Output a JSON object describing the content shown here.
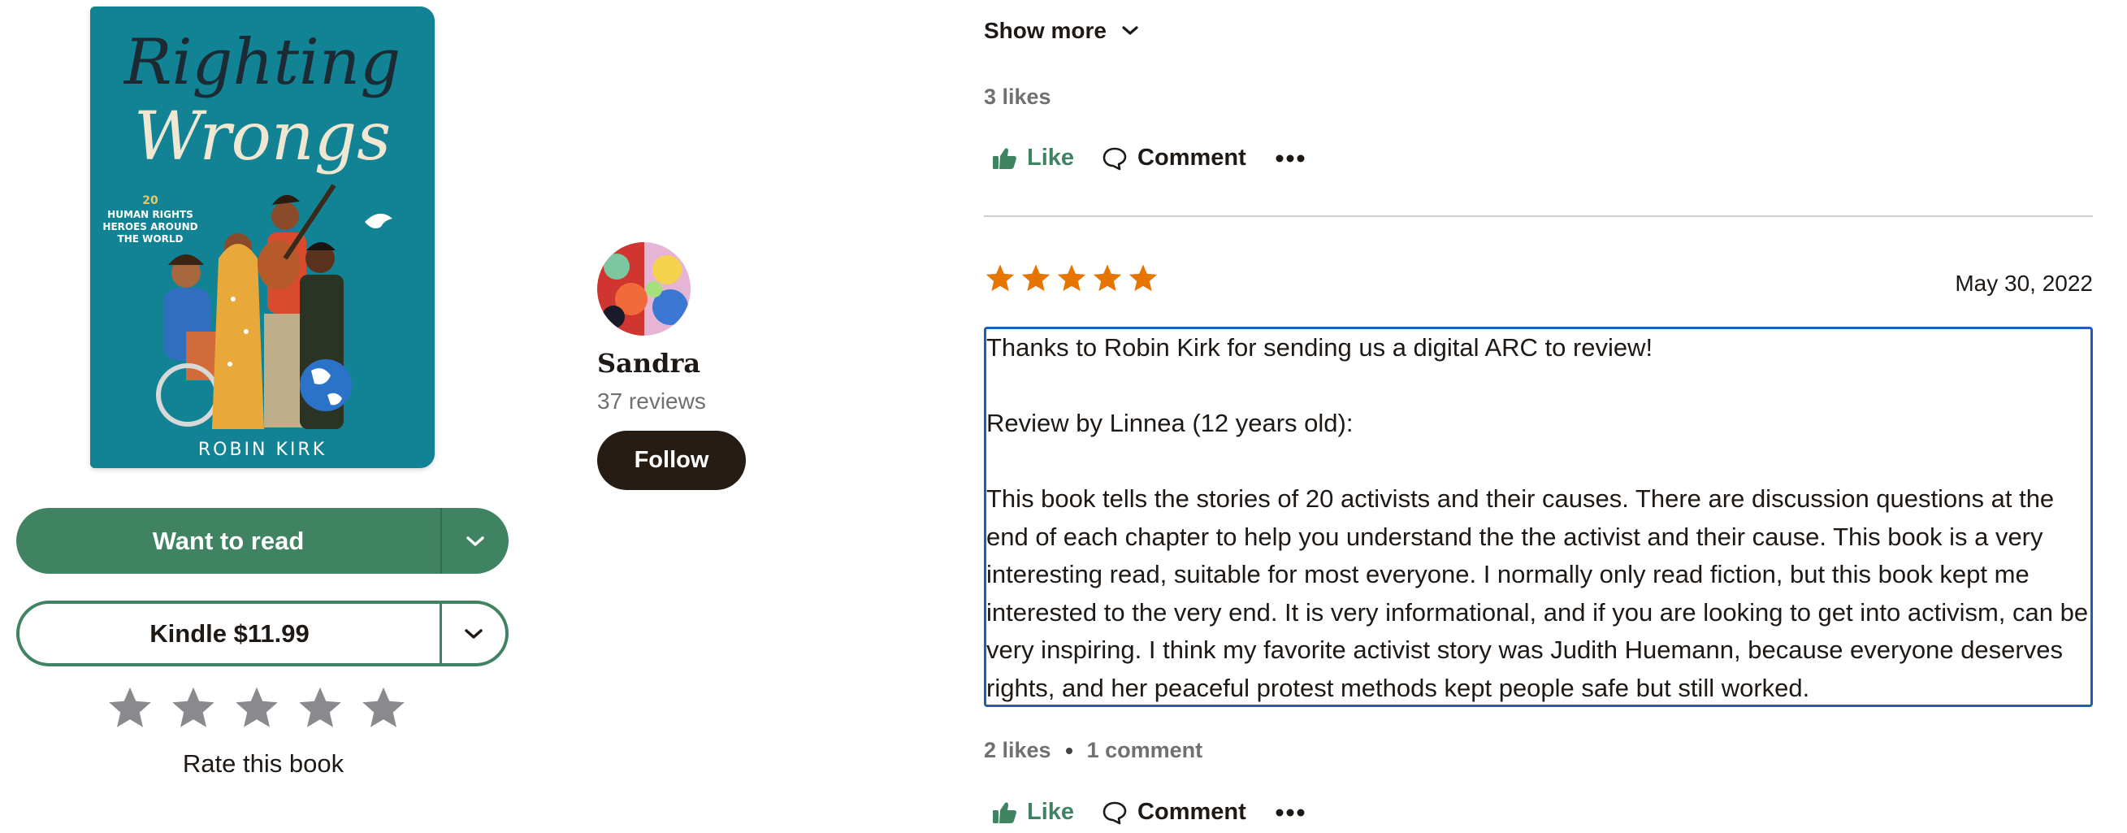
{
  "book": {
    "cover": {
      "title_line1": "Righting",
      "title_line2": "Wrongs",
      "subtitle_num": "20",
      "subtitle_line1": "HUMAN RIGHTS",
      "subtitle_line2": "HEROES AROUND",
      "subtitle_line3": "THE WORLD",
      "author": "ROBIN KIRK",
      "background_color": "#128394"
    },
    "want_to_read_label": "Want to read",
    "kindle_label": "Kindle $11.99",
    "rate_label": "Rate this book",
    "rating_star_count": 5
  },
  "reviewer": {
    "name": "Sandra",
    "reviews": "37 reviews",
    "follow_label": "Follow"
  },
  "previous_review": {
    "show_more_label": "Show more",
    "likes": "3 likes",
    "like_label": "Like",
    "comment_label": "Comment"
  },
  "review": {
    "rating": 5,
    "date": "May 30, 2022",
    "paragraphs": [
      "Thanks to Robin Kirk for sending us a digital ARC to review!",
      "Review by Linnea (12 years old):",
      "This book tells the stories of 20 activists and their causes. There are discussion questions at the end of each chapter to help you understand the the activist and their cause. This book is a very interesting read, suitable for most everyone. I normally only read fiction, but this book kept me interested to the very end. It is very informational, and if you are looking to get into activism, can be very inspiring. I think my favorite activist story was Judith Huemann, because everyone deserves rights, and her peaceful protest methods kept people safe but still worked."
    ],
    "likes": "2 likes",
    "comments": "1 comment",
    "like_label": "Like",
    "comment_label": "Comment"
  },
  "colors": {
    "accent_green": "#3f8363",
    "star_orange": "#e87400",
    "star_gray": "#8a8a8e",
    "follow_dark": "#271c14",
    "focus_blue": "#1f5fb8"
  }
}
